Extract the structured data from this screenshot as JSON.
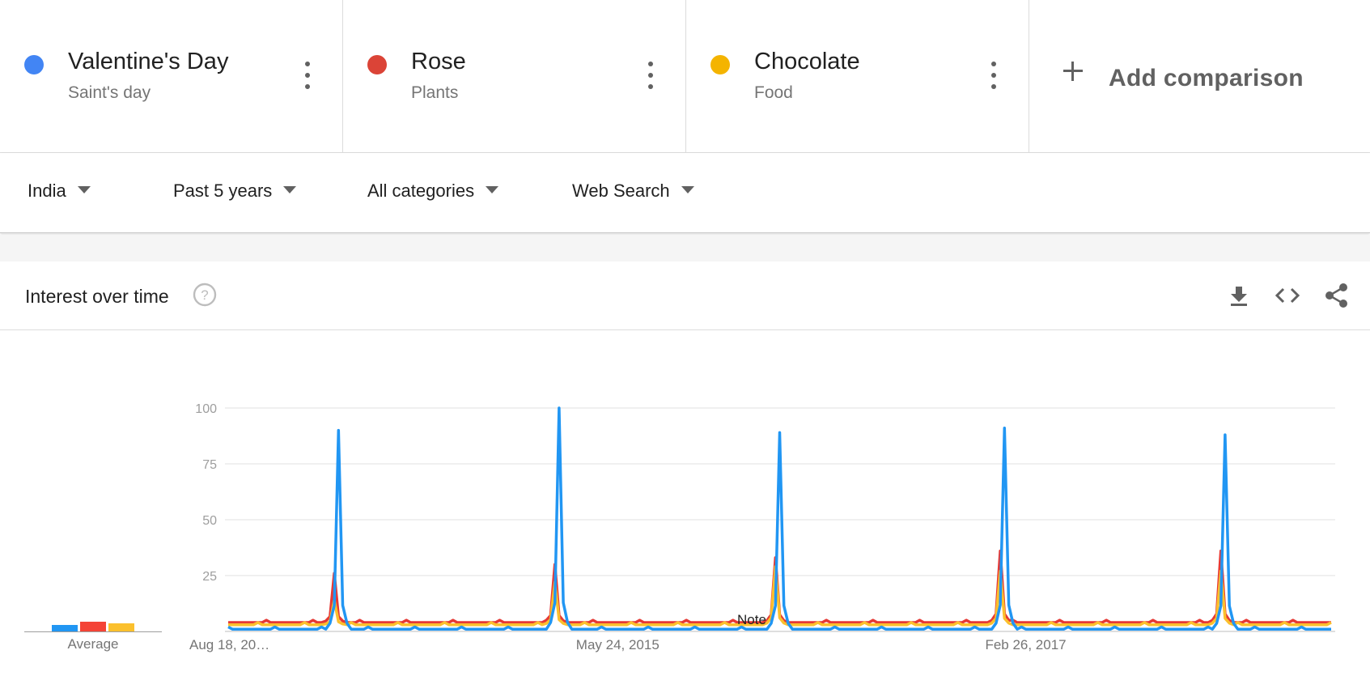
{
  "terms": [
    {
      "name": "Valentine's Day",
      "category": "Saint's day",
      "color": "#4285f4"
    },
    {
      "name": "Rose",
      "category": "Plants",
      "color": "#db4437"
    },
    {
      "name": "Chocolate",
      "category": "Food",
      "color": "#f4b400"
    }
  ],
  "add_comparison": "Add comparison",
  "filters": {
    "region": "India",
    "period": "Past 5 years",
    "category": "All categories",
    "search_type": "Web Search"
  },
  "card": {
    "title": "Interest over time",
    "icons": [
      "help-icon",
      "download-icon",
      "embed-code-icon",
      "share-icon"
    ]
  },
  "average": {
    "label": "Average",
    "values": [
      4,
      6,
      5
    ]
  },
  "note_label": "Note",
  "chart_data": {
    "type": "line",
    "ylim": [
      0,
      100
    ],
    "yticks": [
      25,
      50,
      75,
      100
    ],
    "x_tick_labels": [
      "Aug 18, 20…",
      "May 24, 2015",
      "Feb 26, 2017"
    ],
    "grid": true,
    "weeks": 261,
    "series": [
      {
        "name": "Valentine's Day",
        "color": "#2196f3",
        "baseline": 1,
        "peaks": [
          {
            "week": 26,
            "value": 90
          },
          {
            "week": 78,
            "value": 100
          },
          {
            "week": 130,
            "value": 89
          },
          {
            "week": 183,
            "value": 91
          },
          {
            "week": 235,
            "value": 88
          }
        ]
      },
      {
        "name": "Rose",
        "color": "#e53935",
        "baseline": 4,
        "peaks": [
          {
            "week": 25,
            "value": 26
          },
          {
            "week": 77,
            "value": 30
          },
          {
            "week": 129,
            "value": 33
          },
          {
            "week": 182,
            "value": 36
          },
          {
            "week": 234,
            "value": 36
          }
        ]
      },
      {
        "name": "Chocolate",
        "color": "#fbc02d",
        "baseline": 3,
        "peaks": [
          {
            "week": 25,
            "value": 14
          },
          {
            "week": 77,
            "value": 22
          },
          {
            "week": 129,
            "value": 29
          },
          {
            "week": 182,
            "value": 27
          },
          {
            "week": 234,
            "value": 27
          }
        ]
      }
    ]
  }
}
